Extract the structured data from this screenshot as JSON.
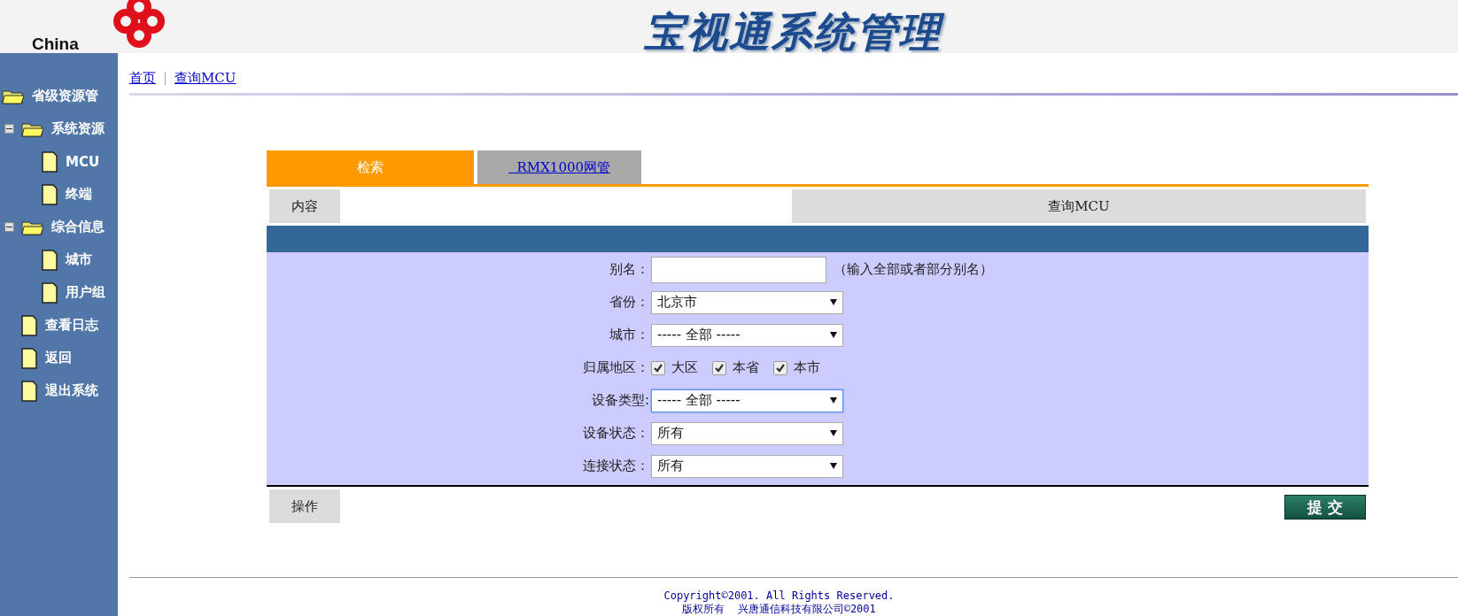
{
  "header": {
    "logo_text": "China",
    "title": "宝视通系统管理"
  },
  "sidebar": {
    "tree": [
      {
        "label": "省级资源管",
        "kind": "folder",
        "children": [
          {
            "label": "系统资源",
            "kind": "folder",
            "expanded": true,
            "children": [
              {
                "label": "MCU",
                "kind": "page"
              },
              {
                "label": "终端",
                "kind": "page"
              }
            ]
          },
          {
            "label": "综合信息",
            "kind": "folder",
            "expanded": true,
            "children": [
              {
                "label": "城市",
                "kind": "page"
              },
              {
                "label": "用户组",
                "kind": "page"
              }
            ]
          },
          {
            "label": "查看日志",
            "kind": "page"
          },
          {
            "label": "返回",
            "kind": "page"
          },
          {
            "label": "退出系统",
            "kind": "page"
          }
        ]
      }
    ]
  },
  "breadcrumb": [
    {
      "label": "首页"
    },
    {
      "label": "查询MCU"
    }
  ],
  "tabs": [
    {
      "label": "检索",
      "selected": true
    },
    {
      "label": "  RMX1000网管",
      "selected": false
    }
  ],
  "content_label": "内容",
  "panel_title": "查询MCU",
  "form": [
    {
      "label": "别名：",
      "kind": "text",
      "hint": "（输入全部或者部分别名）"
    },
    {
      "label": "省份：",
      "kind": "select",
      "value": "北京市",
      "focused": false
    },
    {
      "label": "城市：",
      "kind": "select",
      "value": "----- 全部 -----",
      "focused": false
    },
    {
      "label": "归属地区：",
      "kind": "checks",
      "options": [
        {
          "label": "大区",
          "checked": true
        },
        {
          "label": "本省",
          "checked": true
        },
        {
          "label": "本市",
          "checked": true
        }
      ]
    },
    {
      "label": "设备类型:",
      "kind": "select",
      "value": "----- 全部 -----",
      "focused": true
    },
    {
      "label": "设备状态：",
      "kind": "select",
      "value": "所有",
      "focused": false
    },
    {
      "label": "连接状态：",
      "kind": "select",
      "value": "所有",
      "focused": false
    }
  ],
  "action_label": "操作",
  "submit_button": "提 交",
  "footer": [
    "Copyright©2001. All Rights Reserved.",
    "版权所有  兴唐通信科技有限公司©2001"
  ]
}
